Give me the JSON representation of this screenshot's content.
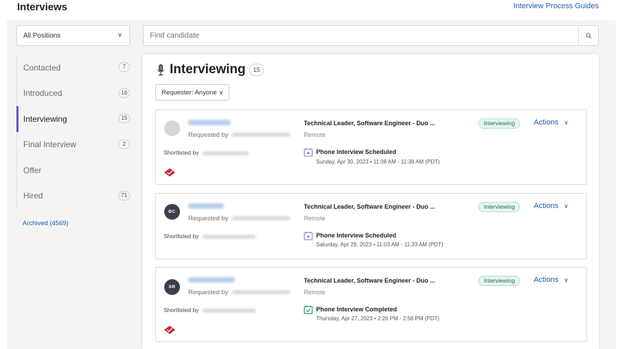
{
  "header": {
    "title": "Interviews",
    "guides_link": "Interview Process Guides"
  },
  "filters": {
    "position_select": "All Positions",
    "search_placeholder": "Find candidate"
  },
  "sidebar": {
    "items": [
      {
        "label": "Contacted",
        "count": "7"
      },
      {
        "label": "Introduced",
        "count": "16"
      },
      {
        "label": "Interviewing",
        "count": "15"
      },
      {
        "label": "Final Interview",
        "count": "2"
      },
      {
        "label": "Offer",
        "count": ""
      },
      {
        "label": "Hired",
        "count": "71"
      }
    ],
    "archived": "Archived (4569)"
  },
  "panel": {
    "title": "Interviewing",
    "count": "15",
    "requester_filter": "Requester: Anyone"
  },
  "cards": [
    {
      "initials": "",
      "requested_label": "Requested by",
      "shortlisted_label": "Shortlisted by",
      "job_title": "Technical Leader, Software Engineer - Duo ...",
      "location": "Remote",
      "event_title": "Phone Interview Scheduled",
      "event_time": "Sunday, Apr 30, 2023 • 11:08 AM - 11:38 AM (PDT)",
      "status": "Interviewing",
      "actions": "Actions"
    },
    {
      "initials": "BC",
      "requested_label": "Requested by",
      "shortlisted_label": "Shortlisted by",
      "job_title": "Technical Leader, Software Engineer - Duo ...",
      "location": "Remote",
      "event_title": "Phone Interview Scheduled",
      "event_time": "Saturday, Apr 29, 2023 • 11:03 AM - 11:33 AM (PDT)",
      "status": "Interviewing",
      "actions": "Actions"
    },
    {
      "initials": "SR",
      "requested_label": "Requested by",
      "shortlisted_label": "Shortlisted by",
      "job_title": "Technical Leader, Software Engineer - Duo ...",
      "location": "Remote",
      "event_title": "Phone Interview Completed",
      "event_time": "Thursday, Apr 27, 2023 • 2:26 PM - 2:56 PM (PDT)",
      "status": "Interviewing",
      "actions": "Actions"
    }
  ],
  "colors": {
    "accent": "#6a4fc9",
    "link": "#1c5fa8",
    "status_bg": "#e3f6ed"
  },
  "icons": {
    "search": "search-icon",
    "microphone": "microphone-icon",
    "calendar": "calendar-icon",
    "calendar_check": "calendar-check-icon",
    "chevron": "chevron-down-icon",
    "shortlist_badge": "shortlist-badge-icon"
  }
}
